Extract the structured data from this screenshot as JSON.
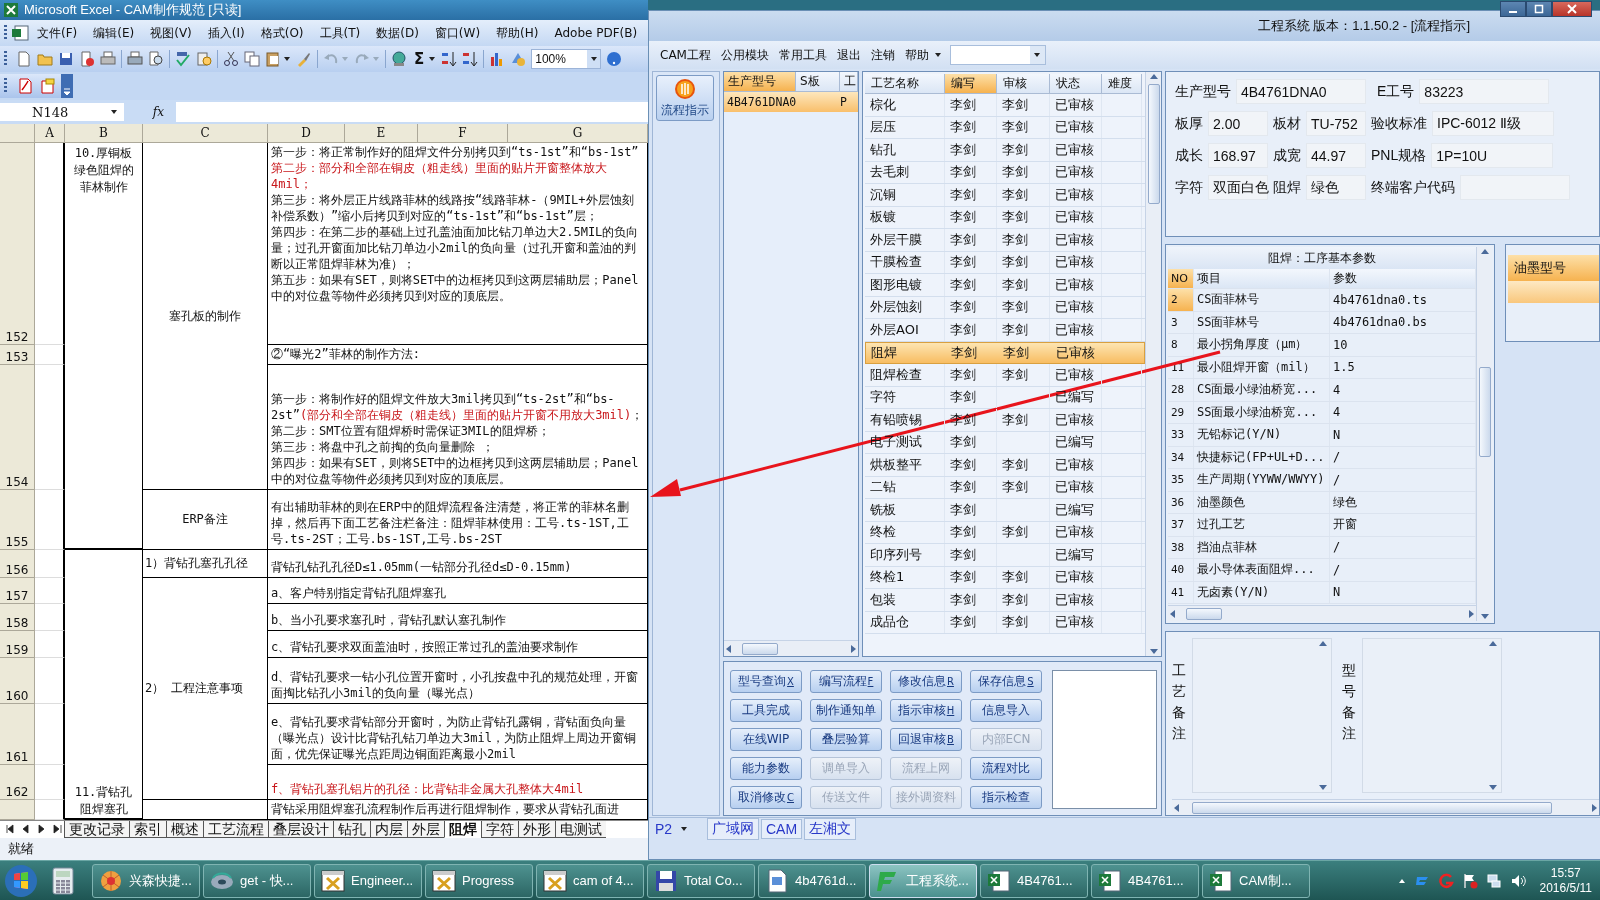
{
  "excel": {
    "title": "Microsoft Excel - CAM制作规范  [只读]",
    "menu": [
      "文件(F)",
      "编辑(E)",
      "视图(V)",
      "插入(I)",
      "格式(O)",
      "工具(T)",
      "数据(D)",
      "窗口(W)",
      "帮助(H)",
      "Adobe PDF(B)"
    ],
    "autosum": "Σ",
    "zoom": "100%",
    "name_box": "N148",
    "formula_symbol": "fx",
    "columns": [
      "A",
      "B",
      "C",
      "D",
      "E",
      "F",
      "G"
    ],
    "row_headers": [
      "152",
      "153",
      "154",
      "155",
      "156",
      "157",
      "158",
      "159",
      "160",
      "161",
      "162"
    ],
    "column_b": [
      "10.厚铜板绿色阻焊的菲林制作",
      "11.背钻孔阻焊塞孔"
    ],
    "column_c": [
      "塞孔板的制作",
      "ERP备注",
      "1）背钻孔塞孔孔径",
      "2）  工程注意事项"
    ],
    "column_d": [
      [
        [
          {
            "text": "第一步：将正常制作好的阻焊文件分别拷贝到“ts-1st”和“bs-1st”",
            "red": false
          }
        ],
        [
          {
            "text": "第二步：部分和全部在铜皮（粗走线）里面的贴片开窗整体放大4mil；",
            "red": true
          }
        ],
        [
          {
            "text": "第三步：将外层正片线路菲林的线路按“线路菲林-（9MIL+外层蚀刻补偿系数）”缩小后拷贝到对应的“ts-1st”和“bs-1st”层；",
            "red": false
          }
        ],
        [
          {
            "text": "第四步：在第二步的基础上过孔盖油面加比钻刀单边大2.5MIL的负向量；过孔开窗面加比钻刀单边小2mil的负向量（过孔开窗和盖油的判断以正常阻焊菲林为准）；",
            "red": false
          }
        ],
        [
          {
            "text": "第五步：如果有SET，则将SET中的边框拷贝到这两层辅助层；Panel中的对位盘等物件必须拷贝到对应的顶底层。",
            "red": false
          }
        ]
      ],
      [
        [
          {
            "text": "②“曝光2”菲林的制作方法:",
            "red": false
          }
        ]
      ],
      [
        [
          {
            "text": "第一步：将制作好的阻焊文件放大3mil拷贝到“ts-2st”和“bs-2st”",
            "red": false
          },
          {
            "text": "(部分和全部在铜皮（粗走线）里面的贴片开窗不用放大3mil)",
            "red": true
          },
          {
            "text": "；",
            "red": false
          }
        ],
        [
          {
            "text": "第二步：SMT位置有阻焊桥时需保证3MIL的阻焊桥；",
            "red": false
          }
        ],
        [
          {
            "text": "第三步：将盘中孔之前掏的负向量删除 ；",
            "red": false
          }
        ],
        [
          {
            "text": "第四步：如果有SET，则将SET中的边框拷贝到这两层辅助层；Panel中的对位盘等物件必须拷贝到对应的顶底层。",
            "red": false
          }
        ]
      ],
      [
        [
          {
            "text": "有出辅助菲林的则在ERP中的阻焊流程备注清楚，将正常的菲林名删掉，然后再下面工艺备注栏备注：阻焊菲林使用：工号.ts-1ST,工号.ts-2ST；工号.bs-1ST,工号.bs-2ST",
            "red": false
          }
        ]
      ],
      [
        [
          {
            "text": "背钻孔钻孔孔径D≤1.05mm(一钻部分孔径d≤D-0.15mm)",
            "red": false
          }
        ]
      ],
      [
        [
          {
            "text": "a、客户特别指定背钻孔阻焊塞孔",
            "red": false
          }
        ]
      ],
      [
        [
          {
            "text": "b、当小孔要求塞孔时，背钻孔默认塞孔制作",
            "red": false
          }
        ]
      ],
      [
        [
          {
            "text": "c、背钻孔要求双面盖油时，按照正常过孔的盖油要求制作",
            "red": false
          }
        ]
      ],
      [
        [
          {
            "text": "d、背钻孔要求一钻小孔位置开窗时，小孔按盘中孔的规范处理，开窗面掏比钻孔小3mil的负向量（曝光点）",
            "red": false
          }
        ]
      ],
      [
        [
          {
            "text": "e、背钻孔要求背钻部分开窗时，为防止背钻孔露铜，背钻面负向量（曝光点）设计比背钻孔钻刀单边大3mil，为防止阻焊上周边开窗铜面，优先保证曝光点距周边铜面距离最小2mil",
            "red": false
          }
        ]
      ],
      [
        [
          {
            "text": "f、背钻孔塞孔铝片的孔径：比背钻非金属大孔整体大4mil",
            "red": true
          }
        ]
      ],
      [
        [
          {
            "text": "背钻采用阻焊塞孔流程制作后再进行阻焊制作，要求从背钻孔面进",
            "red": false
          }
        ]
      ]
    ],
    "sheet_tabs": [
      {
        "label": "更改记录",
        "selected": false
      },
      {
        "label": "索引",
        "selected": false
      },
      {
        "label": "概述",
        "selected": false
      },
      {
        "label": "工艺流程",
        "selected": false
      },
      {
        "label": "叠层设计",
        "selected": false
      },
      {
        "label": "钻孔",
        "selected": false
      },
      {
        "label": "内层",
        "selected": false
      },
      {
        "label": "外层",
        "selected": false
      },
      {
        "label": "阻焊",
        "selected": true
      },
      {
        "label": "字符",
        "selected": false
      },
      {
        "label": "外形",
        "selected": false
      },
      {
        "label": "电测试",
        "selected": false
      }
    ],
    "status": "就绪"
  },
  "app": {
    "title": "工程系统   版本：1.1.50.2 - [流程指示]",
    "menu": [
      "CAM工程",
      "公用模块",
      "常用工具",
      "退出",
      "注销",
      "帮助"
    ],
    "nav_button": "流程指示",
    "models": {
      "columns": [
        {
          "label": "生产型号",
          "selected": true
        },
        {
          "label": "S板",
          "selected": false
        },
        {
          "label": "工",
          "selected": false
        }
      ],
      "rows": [
        {
          "model": "4B4761DNA0",
          "column_3": "P",
          "selected": true
        }
      ]
    },
    "process": {
      "columns": [
        {
          "label": "工艺名称",
          "selected": false
        },
        {
          "label": "编写",
          "selected": true
        },
        {
          "label": "审核",
          "selected": false
        },
        {
          "label": "状态",
          "selected": false
        },
        {
          "label": "难度",
          "selected": false
        }
      ],
      "rows": [
        {
          "name": "棕化",
          "writer": "李剑",
          "reviewer": "李剑",
          "status": "已审核",
          "selected": false
        },
        {
          "name": "层压",
          "writer": "李剑",
          "reviewer": "李剑",
          "status": "已审核",
          "selected": false
        },
        {
          "name": "钻孔",
          "writer": "李剑",
          "reviewer": "李剑",
          "status": "已审核",
          "selected": false
        },
        {
          "name": "去毛刺",
          "writer": "李剑",
          "reviewer": "李剑",
          "status": "已审核",
          "selected": false
        },
        {
          "name": "沉铜",
          "writer": "李剑",
          "reviewer": "李剑",
          "status": "已审核",
          "selected": false
        },
        {
          "name": "板镀",
          "writer": "李剑",
          "reviewer": "李剑",
          "status": "已审核",
          "selected": false
        },
        {
          "name": "外层干膜",
          "writer": "李剑",
          "reviewer": "李剑",
          "status": "已审核",
          "selected": false
        },
        {
          "name": "干膜检查",
          "writer": "李剑",
          "reviewer": "李剑",
          "status": "已审核",
          "selected": false
        },
        {
          "name": "图形电镀",
          "writer": "李剑",
          "reviewer": "李剑",
          "status": "已审核",
          "selected": false
        },
        {
          "name": "外层蚀刻",
          "writer": "李剑",
          "reviewer": "李剑",
          "status": "已审核",
          "selected": false
        },
        {
          "name": "外层AOI",
          "writer": "李剑",
          "reviewer": "李剑",
          "status": "已审核",
          "selected": false
        },
        {
          "name": "阻焊",
          "writer": "李剑",
          "reviewer": "李剑",
          "status": "已审核",
          "selected": true
        },
        {
          "name": "阻焊检查",
          "writer": "李剑",
          "reviewer": "李剑",
          "status": "已审核",
          "selected": false
        },
        {
          "name": "字符",
          "writer": "李剑",
          "status": "已编写",
          "selected": false
        },
        {
          "name": "有铅喷锡",
          "writer": "李剑",
          "reviewer": "李剑",
          "status": "已审核",
          "selected": false
        },
        {
          "name": "电子测试",
          "writer": "李剑",
          "status": "已编写",
          "selected": false
        },
        {
          "name": "烘板整平",
          "writer": "李剑",
          "reviewer": "李剑",
          "status": "已审核",
          "selected": false
        },
        {
          "name": "二钻",
          "writer": "李剑",
          "reviewer": "李剑",
          "status": "已审核",
          "selected": false
        },
        {
          "name": "铣板",
          "writer": "李剑",
          "status": "已编写",
          "selected": false
        },
        {
          "name": "终检",
          "writer": "李剑",
          "reviewer": "李剑",
          "status": "已审核",
          "selected": false
        },
        {
          "name": "印序列号",
          "writer": "李剑",
          "status": "已编写",
          "selected": false
        },
        {
          "name": "终检1",
          "writer": "李剑",
          "reviewer": "李剑",
          "status": "已审核",
          "selected": false
        },
        {
          "name": "包装",
          "writer": "李剑",
          "reviewer": "李剑",
          "status": "已审核",
          "selected": false
        },
        {
          "name": "成品仓",
          "writer": "李剑",
          "reviewer": "李剑",
          "status": "已审核",
          "selected": false
        }
      ]
    },
    "info": [
      [
        {
          "label": "生产型号",
          "value": "4B4761DNA0"
        },
        {
          "label": "E工号",
          "value": "83223"
        }
      ],
      [
        {
          "label": "板厚",
          "value": "2.00"
        },
        {
          "label": "板材",
          "value": "TU-752"
        },
        {
          "label": "验收标准",
          "value": "IPC-6012 Ⅱ级"
        }
      ],
      [
        {
          "label": "成长",
          "value": "168.97"
        },
        {
          "label": "成宽",
          "value": "44.97"
        },
        {
          "label": "PNL规格",
          "value": "1P=10U"
        }
      ],
      [
        {
          "label": "字符",
          "value": "双面白色"
        },
        {
          "label": "阻焊",
          "value": "绿色"
        },
        {
          "label": "终端客户代码"
        }
      ]
    ],
    "params": {
      "title": "阻焊：工序基本参数",
      "columns": [
        "NO",
        "项目",
        "参数"
      ],
      "rows": [
        {
          "no": "2",
          "item": "CS面菲林号",
          "value": "4b4761dna0.ts",
          "selected": true
        },
        {
          "no": "3",
          "item": "SS面菲林号",
          "value": "4b4761dna0.bs",
          "selected": false
        },
        {
          "no": "8",
          "item": "最小拐角厚度（μm）",
          "value": "10",
          "selected": false
        },
        {
          "no": "11",
          "item": "最小阻焊开窗（mil）",
          "value": "1.5",
          "selected": false
        },
        {
          "no": "28",
          "item": "CS面最小绿油桥宽...",
          "value": "4",
          "selected": false
        },
        {
          "no": "29",
          "item": "SS面最小绿油桥宽...",
          "value": "4",
          "selected": false
        },
        {
          "no": "33",
          "item": "无铅标记(Y/N)",
          "value": "N",
          "selected": false
        },
        {
          "no": "34",
          "item": "快捷标记(FP+UL+D...",
          "value": "/",
          "selected": false
        },
        {
          "no": "35",
          "item": "生产周期(YYWW/WWYY)",
          "value": "/",
          "selected": false
        },
        {
          "no": "36",
          "item": "油墨颜色",
          "value": "绿色",
          "selected": false
        },
        {
          "no": "37",
          "item": "过孔工艺",
          "value": "开窗",
          "selected": false
        },
        {
          "no": "38",
          "item": "挡油点菲林",
          "value": "/",
          "selected": false
        },
        {
          "no": "40",
          "item": "最小导体表面阻焊...",
          "value": "/",
          "selected": false
        },
        {
          "no": "41",
          "item": "无卤素(Y/N)",
          "value": "N",
          "selected": false
        }
      ]
    },
    "ink_header": "油墨型号",
    "buttons": [
      {
        "label": "型号查询",
        "key": "X",
        "disabled": false
      },
      {
        "label": "编写流程",
        "key": "F",
        "disabled": false
      },
      {
        "label": "修改信息",
        "key": "R",
        "disabled": false
      },
      {
        "label": "保存信息",
        "key": "S",
        "disabled": false
      },
      {
        "label": "工具完成",
        "disabled": false
      },
      {
        "label": "制作通知单",
        "disabled": false
      },
      {
        "label": "指示审核",
        "key": "H",
        "disabled": false
      },
      {
        "label": "信息导入",
        "disabled": false
      },
      {
        "label": "在线WIP",
        "disabled": false
      },
      {
        "label": "叠层验算",
        "disabled": false
      },
      {
        "label": "回退审核",
        "key": "B",
        "disabled": false
      },
      {
        "label": "内部ECN",
        "disabled": true
      },
      {
        "label": "能力参数",
        "disabled": false
      },
      {
        "label": "调单导入",
        "disabled": true
      },
      {
        "label": "流程上网",
        "disabled": true
      },
      {
        "label": "流程对比",
        "disabled": false
      },
      {
        "label": "取消修改",
        "key": "C",
        "disabled": false
      },
      {
        "label": "传送文件",
        "disabled": true
      },
      {
        "label": "接外调资料",
        "disabled": true
      },
      {
        "label": "指示检查",
        "disabled": false
      }
    ],
    "notes": [
      "工艺备注",
      "型号备注"
    ],
    "footer": {
      "page": "P2",
      "tabs": [
        "广域网",
        "CAM",
        "左湘文"
      ]
    }
  },
  "taskbar": {
    "items": [
      {
        "label": "兴森快捷...",
        "kind": "shell",
        "selected": false
      },
      {
        "label": "get - 快...",
        "kind": "disc",
        "selected": false
      },
      {
        "label": "Engineer...",
        "kind": "window",
        "selected": false
      },
      {
        "label": "Progress",
        "kind": "window",
        "selected": false
      },
      {
        "label": "cam of 4...",
        "kind": "window",
        "selected": false
      },
      {
        "label": "Total Co...",
        "kind": "floppy",
        "selected": false
      },
      {
        "label": "4b4761d...",
        "kind": "document",
        "selected": false
      },
      {
        "label": "工程系统...",
        "kind": "app",
        "selected": true
      },
      {
        "label": "4B4761...",
        "kind": "sheet",
        "selected": false
      },
      {
        "label": "4B4761...",
        "kind": "sheet",
        "selected": false
      },
      {
        "label": "CAM制...",
        "kind": "sheet",
        "selected": false
      }
    ],
    "time": "15:57",
    "date": "2016/5/11"
  }
}
